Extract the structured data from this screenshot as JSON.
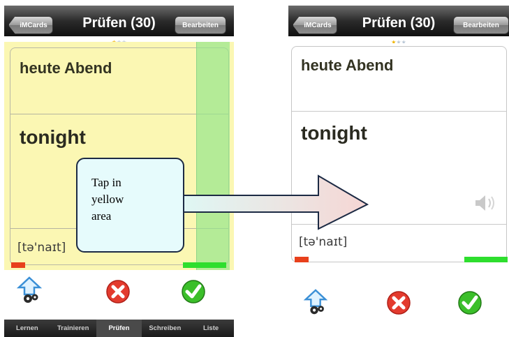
{
  "left_screen": {
    "back_button": "iMCards",
    "title": "Prüfen (30)",
    "edit_button": "Bearbeiten",
    "card": {
      "german": "heute Abend",
      "english": "tonight",
      "phonetic": "[tə'naɪt]"
    },
    "tabs": [
      "Lernen",
      "Trainieren",
      "Prüfen",
      "Schreiben",
      "Liste"
    ],
    "active_tab": "Prüfen"
  },
  "right_screen": {
    "back_button": "iMCards",
    "title": "Prüfen (30)",
    "edit_button": "Bearbeiten",
    "card": {
      "german": "heute Abend",
      "english": "tonight",
      "phonetic": "[tə'naɪt]"
    }
  },
  "callout": {
    "line1": "Tap in",
    "line2": "yellow",
    "line3": "area"
  },
  "icons": {
    "settings": "settings-gears-icon",
    "wrong": "red-x-icon",
    "right": "green-check-icon",
    "speaker": "speaker-icon",
    "star": "rating-stars-icon"
  },
  "colors": {
    "yellow_area": "#fbf7b3",
    "green_strip": "#96e68c",
    "callout_fill": "#e6fbfc",
    "red_bar": "#e8401c",
    "green_bar": "#2ede2e"
  },
  "rating": {
    "filled": 1,
    "total": 3
  }
}
